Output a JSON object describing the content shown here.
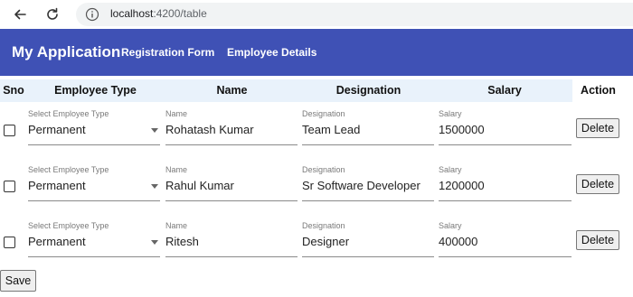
{
  "browser": {
    "url_host": "localhost",
    "url_path": ":4200/table"
  },
  "app": {
    "title": "My Application",
    "nav": [
      "Registration Form",
      "Employee Details"
    ]
  },
  "table": {
    "headers": [
      "Sno",
      "Employee Type",
      "Name",
      "Designation",
      "Salary",
      "Action"
    ],
    "field_labels": {
      "type": "Select Employee Type",
      "name": "Name",
      "designation": "Designation",
      "salary": "Salary"
    },
    "rows": [
      {
        "type": "Permanent",
        "name": "Rohatash Kumar",
        "designation": "Team Lead",
        "salary": "1500000",
        "checked": false
      },
      {
        "type": "Permanent",
        "name": "Rahul Kumar",
        "designation": "Sr Software Developer",
        "salary": "1200000",
        "checked": false
      },
      {
        "type": "Permanent",
        "name": "Ritesh",
        "designation": "Designer",
        "salary": "400000",
        "checked": false
      }
    ],
    "delete_label": "Delete",
    "save_label": "Save"
  }
}
